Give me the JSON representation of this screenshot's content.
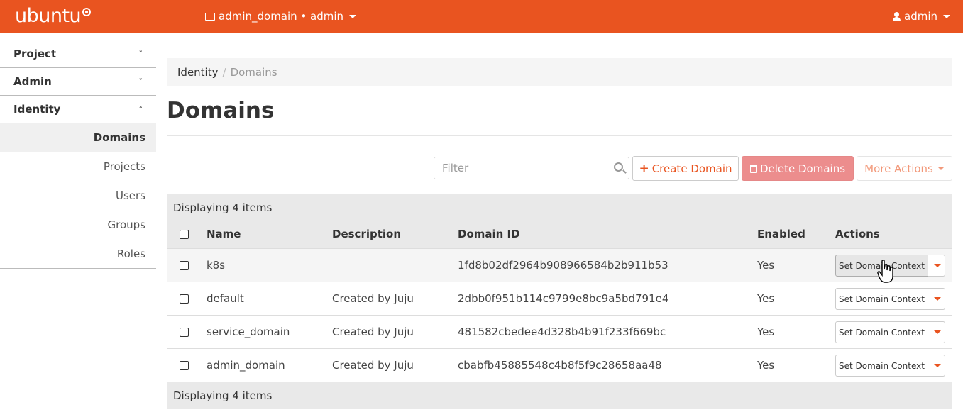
{
  "topbar": {
    "logo": "ubuntu",
    "context_label": "admin_domain • admin",
    "user_label": "admin",
    "accent_color": "#e95420"
  },
  "sidebar": {
    "groups": [
      {
        "label": "Project",
        "chevron": "˅"
      },
      {
        "label": "Admin",
        "chevron": "˅"
      },
      {
        "label": "Identity",
        "chevron": "˄"
      }
    ],
    "items": [
      {
        "label": "Domains"
      },
      {
        "label": "Projects"
      },
      {
        "label": "Users"
      },
      {
        "label": "Groups"
      },
      {
        "label": "Roles"
      }
    ]
  },
  "breadcrumb": {
    "parent": "Identity",
    "sep": "/",
    "current": "Domains"
  },
  "page": {
    "title": "Domains"
  },
  "toolbar": {
    "filter_placeholder": "Filter",
    "create_label": "Create Domain",
    "delete_label": "Delete Domains",
    "more_label": "More Actions"
  },
  "table": {
    "count_label": "Displaying 4 items",
    "headers": {
      "name": "Name",
      "description": "Description",
      "domain_id": "Domain ID",
      "enabled": "Enabled",
      "actions": "Actions"
    },
    "rows": [
      {
        "name": "k8s",
        "description": "",
        "domain_id": "1fd8b02df2964b908966584b2b911b53",
        "enabled": "Yes",
        "action": "Set Domain Context"
      },
      {
        "name": "default",
        "description": "Created by Juju",
        "domain_id": "2dbb0f951b114c9799e8bc9a5bd791e4",
        "enabled": "Yes",
        "action": "Set Domain Context"
      },
      {
        "name": "service_domain",
        "description": "Created by Juju",
        "domain_id": "481582cbedee4d328b4b91f233f669bc",
        "enabled": "Yes",
        "action": "Set Domain Context"
      },
      {
        "name": "admin_domain",
        "description": "Created by Juju",
        "domain_id": "cbabfb45885548c4b8f5f9c28658aa48",
        "enabled": "Yes",
        "action": "Set Domain Context"
      }
    ],
    "footer_label": "Displaying 4 items"
  }
}
